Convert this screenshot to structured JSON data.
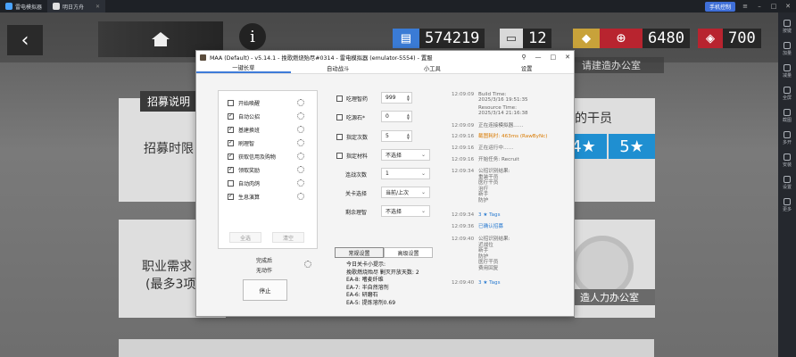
{
  "emulator": {
    "tabs": [
      {
        "label": "雷电模拟器"
      },
      {
        "label": "明日方舟"
      }
    ],
    "remote_control": "手机控制",
    "sidebar": [
      {
        "label": "按键"
      },
      {
        "label": "加量"
      },
      {
        "label": "减量"
      },
      {
        "label": "全屏"
      },
      {
        "label": "截图"
      },
      {
        "label": "多开"
      },
      {
        "label": "安装"
      },
      {
        "label": "设置"
      },
      {
        "label": "更多"
      }
    ]
  },
  "game": {
    "resources": [
      {
        "value": "574219",
        "color": "#3a7bd5"
      },
      {
        "value": "12",
        "color": "#8b8b8b"
      },
      {
        "value": "6480",
        "color": "#b8242f"
      },
      {
        "value": "700",
        "color": "#b8242f"
      }
    ],
    "cards": {
      "recruit_tip": "招募说明",
      "recruit_time": "招募时限",
      "class_req": "职业需求",
      "class_req_sub": "(最多3项)",
      "request_office": "请建造办公室",
      "operator_partial": "的干员",
      "stars_4": "4★",
      "stars_5": "5★",
      "hr_office": "造人力办公室"
    }
  },
  "maa": {
    "title": "MAA (Default) - v5.14.1 - 挽歌燃烧殆尽#0314 - 雷电模拟器 (emulator-5554) - 置服",
    "tabs": [
      "一键长草",
      "自动战斗",
      "小工具",
      "设置"
    ],
    "tasks": [
      {
        "label": "开始唤醒",
        "checked": false
      },
      {
        "label": "自动公招",
        "checked": true
      },
      {
        "label": "基建换班",
        "checked": true
      },
      {
        "label": "刷理智",
        "checked": true
      },
      {
        "label": "获取信用及购物",
        "checked": true
      },
      {
        "label": "领取奖励",
        "checked": true
      },
      {
        "label": "自动肉鸽",
        "checked": false
      },
      {
        "label": "生息演算",
        "checked": true
      }
    ],
    "select_all": "全选",
    "clear": "清空",
    "after_complete": "完成后",
    "after_action": "无动作",
    "stop": "停止",
    "options": {
      "medicine_label": "吃理智药",
      "medicine_value": "999",
      "stone_label": "吃源石*",
      "stone_value": "0",
      "times_label": "指定次数",
      "times_value": "5",
      "material_label": "指定材料",
      "material_value": "不选择",
      "series_label": "连战次数",
      "series_value": "1",
      "stage_label": "关卡选择",
      "stage_value": "当前/上次",
      "remain_label": "剩余理智",
      "remain_value": "不选择"
    },
    "settings_tabs": [
      "常规设置",
      "高级设置"
    ],
    "notice": [
      "今日关卡小提示:",
      "挽歌燃烧殆尽 剿灭开放天数: 2",
      "EA-8: 嗜麦纤维",
      "EA-7: 半自然溶剂",
      "EA-6: 研磨石",
      "EA-5: 提炼溶剂0.69"
    ],
    "log": [
      {
        "time": "12:09:09",
        "msg": "Build Time:",
        "style": ""
      },
      {
        "time": "",
        "msg": "2025/3/16 19:51:35",
        "style": ""
      },
      {
        "time": "",
        "msg": "Resource Time:",
        "style": ""
      },
      {
        "time": "",
        "msg": "2025/3/14 21:16:38",
        "style": ""
      },
      {
        "time": "12:09:09",
        "msg": "正在连接模拟器……",
        "style": ""
      },
      {
        "time": "12:09:16",
        "msg": "截图耗时: 463ms (RawByNc)",
        "style": "warn"
      },
      {
        "time": "12:09:16",
        "msg": "正在运行中……",
        "style": ""
      },
      {
        "time": "12:09:16",
        "msg": "开始任务: Recruit",
        "style": ""
      },
      {
        "time": "12:09:34",
        "msg": "公招识别结果:",
        "style": ""
      },
      {
        "time": "",
        "msg": "重装干员",
        "style": ""
      },
      {
        "time": "",
        "msg": "医疗干员",
        "style": ""
      },
      {
        "time": "",
        "msg": "治疗",
        "style": ""
      },
      {
        "time": "",
        "msg": "新手",
        "style": ""
      },
      {
        "time": "",
        "msg": "防护",
        "style": ""
      },
      {
        "time": "12:09:34",
        "msg": "3 ★ Tags",
        "style": "info"
      },
      {
        "time": "12:09:36",
        "msg": "已确认招募",
        "style": "info"
      },
      {
        "time": "12:09:40",
        "msg": "公招识别结果:",
        "style": ""
      },
      {
        "time": "",
        "msg": "近战位",
        "style": ""
      },
      {
        "time": "",
        "msg": "新手",
        "style": ""
      },
      {
        "time": "",
        "msg": "防护",
        "style": ""
      },
      {
        "time": "",
        "msg": "医疗干员",
        "style": ""
      },
      {
        "time": "",
        "msg": "费用回复",
        "style": ""
      },
      {
        "time": "12:09:40",
        "msg": "3 ★ Tags",
        "style": "info"
      }
    ]
  }
}
